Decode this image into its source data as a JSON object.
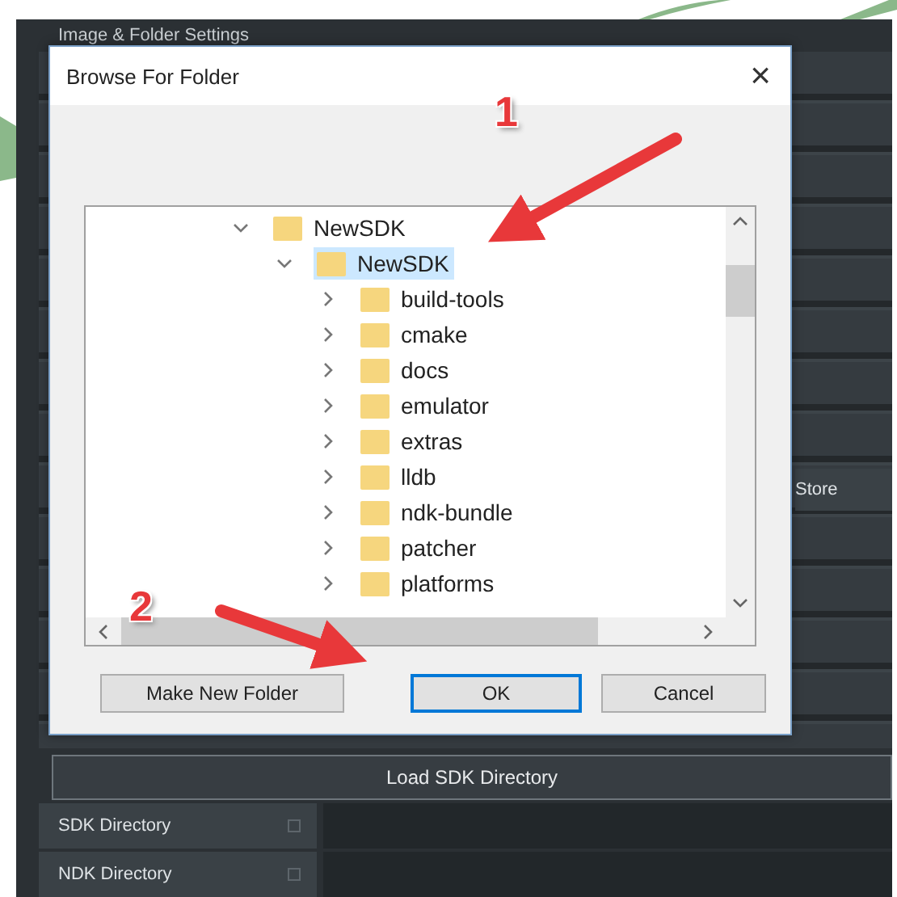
{
  "app": {
    "section_title": "Image & Folder Settings",
    "side_button": "Store",
    "load_button": "Load SDK Directory",
    "fields": [
      {
        "label": "SDK Directory"
      },
      {
        "label": "NDK Directory"
      }
    ]
  },
  "dialog": {
    "title": "Browse For Folder",
    "close": "×",
    "tree": [
      {
        "label": "NewSDK",
        "expanded": true,
        "selected": false,
        "children": [
          {
            "label": "NewSDK",
            "expanded": true,
            "selected": true,
            "children": [
              {
                "label": "build-tools",
                "expanded": false,
                "selected": false
              },
              {
                "label": "cmake",
                "expanded": false,
                "selected": false
              },
              {
                "label": "docs",
                "expanded": false,
                "selected": false
              },
              {
                "label": "emulator",
                "expanded": false,
                "selected": false
              },
              {
                "label": "extras",
                "expanded": false,
                "selected": false
              },
              {
                "label": "lldb",
                "expanded": false,
                "selected": false
              },
              {
                "label": "ndk-bundle",
                "expanded": false,
                "selected": false
              },
              {
                "label": "patcher",
                "expanded": false,
                "selected": false
              },
              {
                "label": "platforms",
                "expanded": false,
                "selected": false
              }
            ]
          }
        ]
      }
    ],
    "buttons": [
      {
        "label": "Make New Folder",
        "default": false
      },
      {
        "label": "OK",
        "default": true
      },
      {
        "label": "Cancel",
        "default": false
      }
    ]
  },
  "annotations": [
    {
      "label": "1"
    },
    {
      "label": "2"
    }
  ]
}
